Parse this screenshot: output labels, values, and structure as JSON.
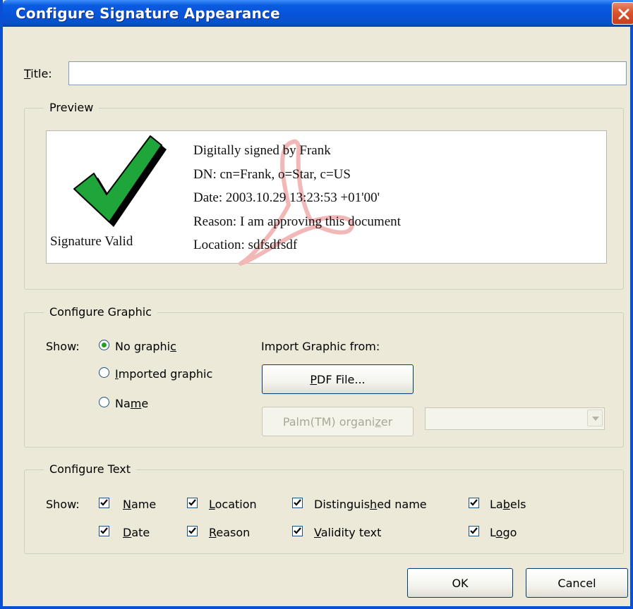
{
  "window": {
    "title": "Configure Signature Appearance"
  },
  "title_field": {
    "label_prefix": "",
    "label_mnemonic": "T",
    "label_rest": "itle:",
    "value": ""
  },
  "preview": {
    "legend": "Preview",
    "graphic_caption": "Signature Valid",
    "lines": [
      "Digitally signed by Frank",
      "DN: cn=Frank, o=Star, c=US",
      "Date: 2003.10.29 13:23:53 +01'00'",
      "Reason: I am approving this document",
      "Location: sdfsdfsdf"
    ],
    "check_color": "#1fa63a",
    "watermark_color": "#f2b8b8"
  },
  "configure_graphic": {
    "legend": "Configure Graphic",
    "show_label": "Show:",
    "options": [
      {
        "pre": "No graphi",
        "mn": "c",
        "post": "",
        "selected": true
      },
      {
        "pre": "",
        "mn": "I",
        "post": "mported graphic",
        "selected": false
      },
      {
        "pre": "Na",
        "mn": "m",
        "post": "e",
        "selected": false
      }
    ],
    "import_label": "Import Graphic from:",
    "pdf_button": {
      "pre": "",
      "mn": "P",
      "post": "DF File..."
    },
    "palm_button": {
      "pre": "Palm(TM) organi",
      "mn": "z",
      "post": "er"
    },
    "palm_select_value": ""
  },
  "configure_text": {
    "legend": "Configure Text",
    "show_label": "Show:",
    "items": [
      {
        "pre": "",
        "mn": "N",
        "post": "ame",
        "checked": true
      },
      {
        "pre": "",
        "mn": "L",
        "post": "ocation",
        "checked": true
      },
      {
        "pre": "Distinguis",
        "mn": "h",
        "post": "ed name",
        "checked": true
      },
      {
        "pre": "La",
        "mn": "b",
        "post": "els",
        "checked": true
      },
      {
        "pre": "",
        "mn": "D",
        "post": "ate",
        "checked": true
      },
      {
        "pre": "",
        "mn": "R",
        "post": "eason",
        "checked": true
      },
      {
        "pre": "",
        "mn": "V",
        "post": "alidity text",
        "checked": true
      },
      {
        "pre": "L",
        "mn": "o",
        "post": "go",
        "checked": true
      }
    ]
  },
  "footer": {
    "ok_label": "OK",
    "cancel_label": "Cancel"
  }
}
